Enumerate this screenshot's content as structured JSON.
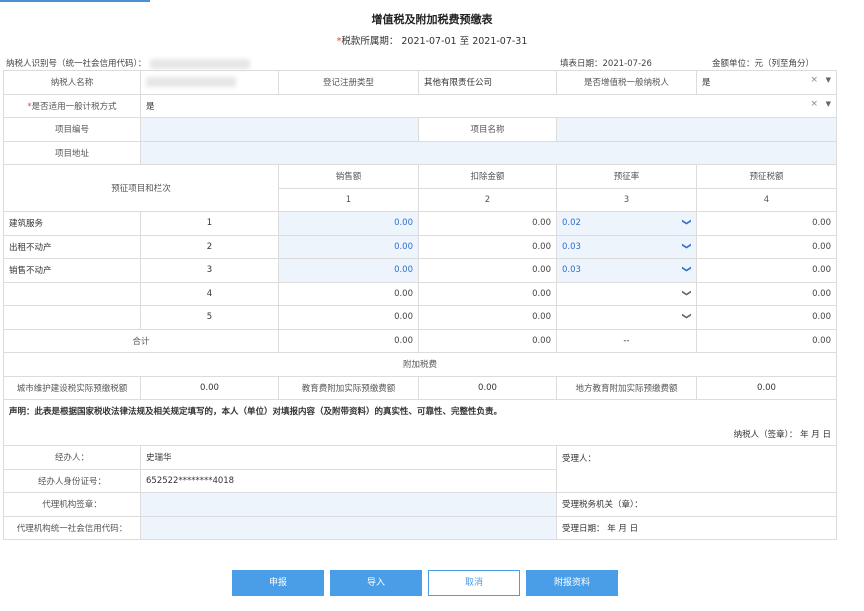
{
  "title": "增值税及附加税费预缴表",
  "period": {
    "label": "税款所属期：",
    "from": "2021-07-01",
    "sep": "至",
    "to": "2021-07-31"
  },
  "header": {
    "taxpayer_id_label": "纳税人识别号（统一社会信用代码）：",
    "fill_date_label": "填表日期：2021-07-26",
    "unit_label": "金额单位：元（列至角分）"
  },
  "taxpayer": {
    "name_label": "纳税人名称",
    "reg_type_label": "登记注册类型",
    "reg_type_value": "其他有限责任公司",
    "general_label": "是否增值税一般纳税人",
    "general_value": "是",
    "simple_label": "是否适用一般计税方式",
    "simple_value": "是",
    "project_no_label": "项目编号",
    "project_name_label": "项目名称",
    "project_addr_label": "项目地址"
  },
  "columns": {
    "item_label": "预征项目和栏次",
    "sales": "销售额",
    "deduct": "扣除金额",
    "rate": "预征率",
    "tax": "预征税额",
    "n1": "1",
    "n2": "2",
    "n3": "3",
    "n4": "4"
  },
  "rows": [
    {
      "name": "建筑服务",
      "no": "1",
      "sales": "0.00",
      "deduct": "0.00",
      "rate": "0.02",
      "tax": "0.00"
    },
    {
      "name": "出租不动产",
      "no": "2",
      "sales": "0.00",
      "deduct": "0.00",
      "rate": "0.03",
      "tax": "0.00"
    },
    {
      "name": "销售不动产",
      "no": "3",
      "sales": "0.00",
      "deduct": "0.00",
      "rate": "0.03",
      "tax": "0.00"
    },
    {
      "name": "",
      "no": "4",
      "sales": "0.00",
      "deduct": "0.00",
      "rate": "",
      "tax": "0.00"
    },
    {
      "name": "",
      "no": "5",
      "sales": "0.00",
      "deduct": "0.00",
      "rate": "",
      "tax": "0.00"
    }
  ],
  "total": {
    "label": "合计",
    "sales": "0.00",
    "deduct": "0.00",
    "rate": "--",
    "tax": "0.00"
  },
  "surtax": {
    "section_label": "附加税费",
    "city_label": "城市维护建设税实际预缴税额",
    "city_value": "0.00",
    "edu_label": "教育费附加实际预缴费额",
    "edu_value": "0.00",
    "local_label": "地方教育附加实际预缴费额",
    "local_value": "0.00"
  },
  "declaration": "声明：此表是根据国家税收法律法规及相关规定填写的，本人（单位）对填报内容（及附带资料）的真实性、可靠性、完整性负责。",
  "sign": "纳税人（签章）：  年  月  日",
  "agent": {
    "handler_label": "经办人：",
    "handler_value": "史瑞华",
    "id_label": "经办人身份证号：",
    "id_value": "652522********4018",
    "agency_label": "代理机构签章：",
    "agency_code_label": "代理机构统一社会信用代码：",
    "receiver_label": "受理人：",
    "office_label": "受理税务机关（章）：",
    "date_label": "受理日期：  年  月  日"
  },
  "buttons": {
    "submit": "申报",
    "import": "导入",
    "cancel": "取消",
    "attach": "附报资料"
  }
}
